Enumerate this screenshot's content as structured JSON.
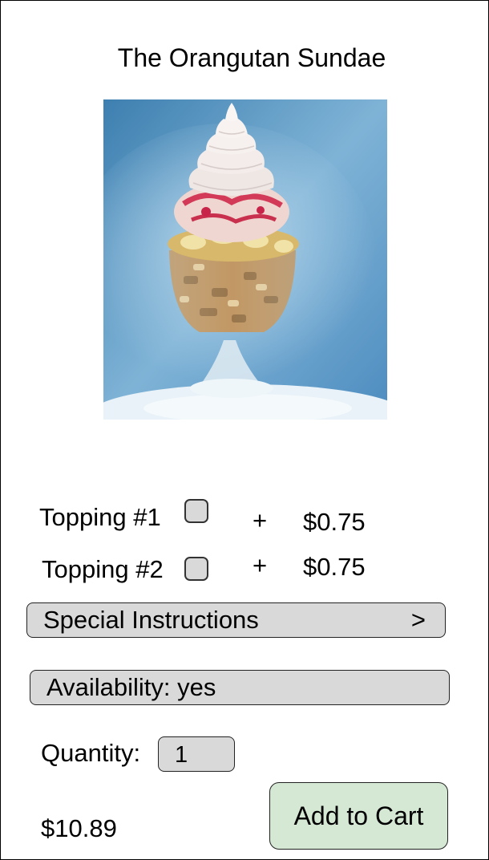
{
  "product": {
    "title": "The Orangutan Sundae",
    "price": "$10.89"
  },
  "toppings": [
    {
      "label": "Topping #1",
      "plus": "+",
      "price": "$0.75",
      "checked": false
    },
    {
      "label": "Topping #2",
      "plus": "+",
      "price": "$0.75",
      "checked": false
    }
  ],
  "special_instructions": {
    "label": "Special Instructions",
    "chevron": ">"
  },
  "availability": {
    "label": "Availability: yes"
  },
  "quantity": {
    "label": "Quantity:",
    "value": "1"
  },
  "cart_button": {
    "label": "Add to Cart"
  },
  "colors": {
    "field_gray": "#d9d9d9",
    "cart_green": "#d5e8d4"
  }
}
